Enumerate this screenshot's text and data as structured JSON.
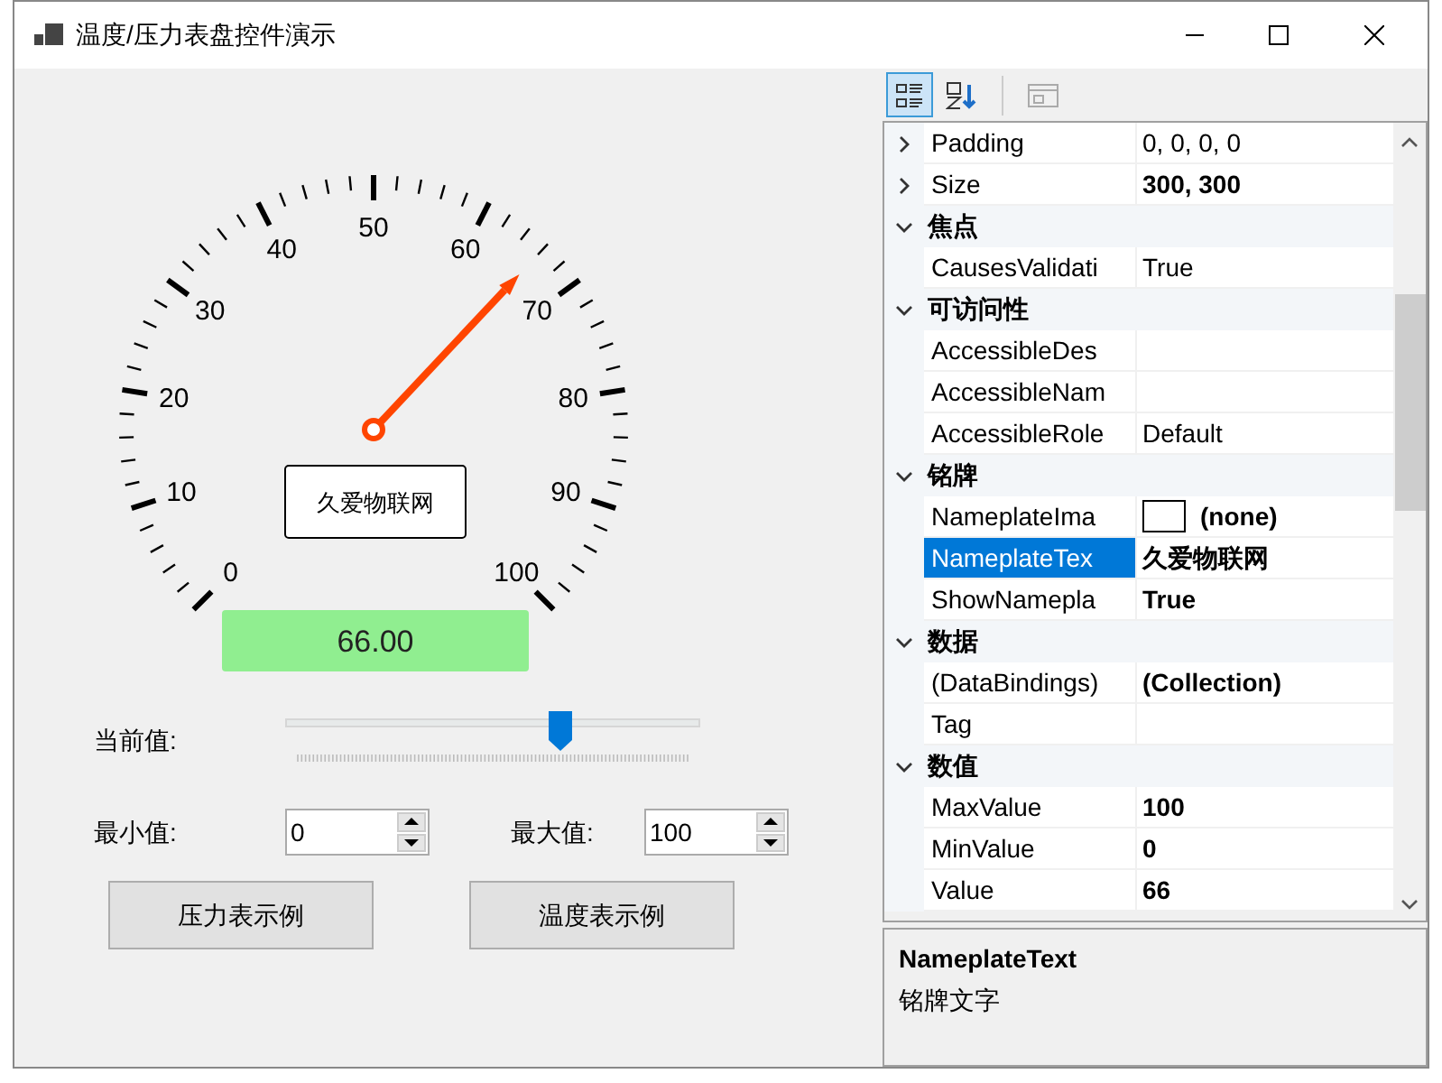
{
  "window": {
    "title": "温度/压力表盘控件演示"
  },
  "gauge": {
    "scale_labels": [
      "0",
      "10",
      "20",
      "30",
      "40",
      "50",
      "60",
      "70",
      "80",
      "90",
      "100"
    ],
    "level": 0.66,
    "nameplate": "久爱物联网",
    "reading": "66.00"
  },
  "current_value": {
    "label": "当前值:",
    "level": 0.66
  },
  "min_value": {
    "label": "最小值:",
    "value": "0"
  },
  "max_value": {
    "label": "最大值:",
    "value": "100"
  },
  "buttons": [
    "压力表示例",
    "温度表示例"
  ],
  "property_grid": {
    "toolbar": [
      {
        "kind": "categorized",
        "selected": true,
        "disabled": false
      },
      {
        "kind": "alphabetical",
        "selected": false,
        "disabled": false
      },
      {
        "kind": "pages",
        "selected": false,
        "disabled": true
      }
    ],
    "rows": [
      {
        "kind": "property",
        "name": "Padding",
        "value": "0, 0, 0, 0",
        "bold": false,
        "selected": false,
        "expandable": true
      },
      {
        "kind": "property",
        "name": "Size",
        "value": "300, 300",
        "bold": true,
        "selected": false,
        "expandable": true
      },
      {
        "kind": "category",
        "label": "焦点",
        "expanded": true
      },
      {
        "kind": "property",
        "name": "CausesValidati",
        "value": "True",
        "bold": false,
        "selected": false,
        "expandable": false
      },
      {
        "kind": "category",
        "label": "可访问性",
        "expanded": true
      },
      {
        "kind": "property",
        "name": "AccessibleDes",
        "selected": false,
        "expandable": false
      },
      {
        "kind": "property",
        "name": "AccessibleNam",
        "selected": false,
        "expandable": false
      },
      {
        "kind": "property",
        "name": "AccessibleRole",
        "value": "Default",
        "bold": false,
        "selected": false,
        "expandable": false
      },
      {
        "kind": "category",
        "label": "铭牌",
        "expanded": true
      },
      {
        "kind": "image",
        "name": "NameplateIma",
        "value": "(none)",
        "bold": true,
        "selected": false,
        "expandable": false
      },
      {
        "kind": "property",
        "name": "NameplateTex",
        "value": "久爱物联网",
        "bold": true,
        "selected": true,
        "expandable": false
      },
      {
        "kind": "property",
        "name": "ShowNamepla",
        "value": "True",
        "bold": true,
        "selected": false,
        "expandable": false
      },
      {
        "kind": "category",
        "label": "数据",
        "expanded": true
      },
      {
        "kind": "property",
        "name": "(DataBindings)",
        "value": "(Collection)",
        "bold": true,
        "selected": false,
        "expandable": false
      },
      {
        "kind": "property",
        "name": "Tag",
        "selected": false,
        "expandable": false
      },
      {
        "kind": "category",
        "label": "数值",
        "expanded": true
      },
      {
        "kind": "property",
        "name": "MaxValue",
        "value": "100",
        "bold": true,
        "selected": false,
        "expandable": false
      },
      {
        "kind": "property",
        "name": "MinValue",
        "value": "0",
        "bold": true,
        "selected": false,
        "expandable": false
      },
      {
        "kind": "property",
        "name": "Value",
        "value": "66",
        "bold": true,
        "selected": false,
        "expandable": false
      }
    ],
    "description": {
      "title": "NameplateText",
      "text": "铭牌文字"
    }
  }
}
